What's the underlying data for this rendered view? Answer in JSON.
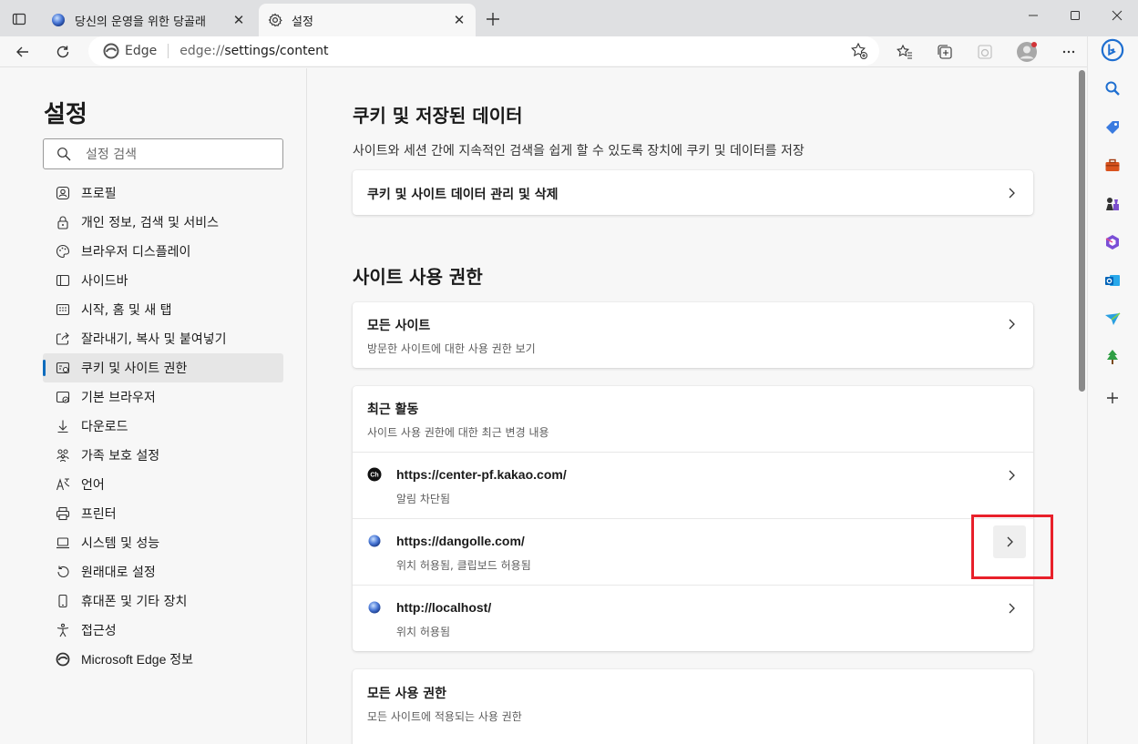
{
  "browser": {
    "tabs": [
      {
        "title": "당신의 운영을 위한 당골래",
        "icon": "globe-icon",
        "active": false
      },
      {
        "title": "설정",
        "icon": "gear-icon",
        "active": true
      }
    ],
    "address": {
      "site_label": "Edge",
      "url_scheme": "edge://",
      "url_rest": "settings/content"
    }
  },
  "settings_nav": {
    "title": "설정",
    "search_placeholder": "설정 검색",
    "items": [
      {
        "label": "프로필",
        "icon": "profile-icon"
      },
      {
        "label": "개인 정보, 검색 및 서비스",
        "icon": "lock-icon"
      },
      {
        "label": "브라우저 디스플레이",
        "icon": "palette-icon"
      },
      {
        "label": "사이드바",
        "icon": "sidebar-icon"
      },
      {
        "label": "시작, 홈 및 새 탭",
        "icon": "home-tab-icon"
      },
      {
        "label": "잘라내기, 복사 및 붙여넣기",
        "icon": "share-icon"
      },
      {
        "label": "쿠키 및 사이트 권한",
        "icon": "cookie-permissions-icon",
        "selected": true
      },
      {
        "label": "기본 브라우저",
        "icon": "default-browser-icon"
      },
      {
        "label": "다운로드",
        "icon": "download-icon"
      },
      {
        "label": "가족 보호 설정",
        "icon": "family-icon"
      },
      {
        "label": "언어",
        "icon": "language-icon"
      },
      {
        "label": "프린터",
        "icon": "printer-icon"
      },
      {
        "label": "시스템 및 성능",
        "icon": "laptop-icon"
      },
      {
        "label": "원래대로 설정",
        "icon": "reset-icon"
      },
      {
        "label": "휴대폰 및 기타 장치",
        "icon": "phone-icon"
      },
      {
        "label": "접근성",
        "icon": "accessibility-icon"
      },
      {
        "label": "Microsoft Edge 정보",
        "icon": "edge-logo-icon"
      }
    ]
  },
  "cookies_section": {
    "title": "쿠키 및 저장된 데이터",
    "description": "사이트와 세션 간에 지속적인 검색을 쉽게 할 수 있도록 장치에 쿠키 및 데이터를 저장",
    "manage_label": "쿠키 및 사이트 데이터 관리 및 삭제"
  },
  "permissions_section": {
    "title": "사이트 사용 권한",
    "all_sites": {
      "title": "모든 사이트",
      "subtitle": "방문한 사이트에 대한 사용 권한 보기"
    },
    "recent": {
      "title": "최근 활동",
      "subtitle": "사이트 사용 권한에 대한 최근 변경 내용",
      "sites": [
        {
          "url": "https://center-pf.kakao.com/",
          "status": "알림 차단됨",
          "icon": "kakao-channel-icon"
        },
        {
          "url": "https://dangolle.com/",
          "status": "위치 허용됨, 클립보드 허용됨",
          "icon": "globe-icon"
        },
        {
          "url": "http://localhost/",
          "status": "위치 허용됨",
          "icon": "globe-icon"
        }
      ]
    },
    "all_permissions": {
      "title": "모든 사용 권한",
      "subtitle": "모든 사이트에 적용되는 사용 권한"
    }
  },
  "colors": {
    "accent": "#0f6cbd",
    "highlight": "#e8202a"
  }
}
